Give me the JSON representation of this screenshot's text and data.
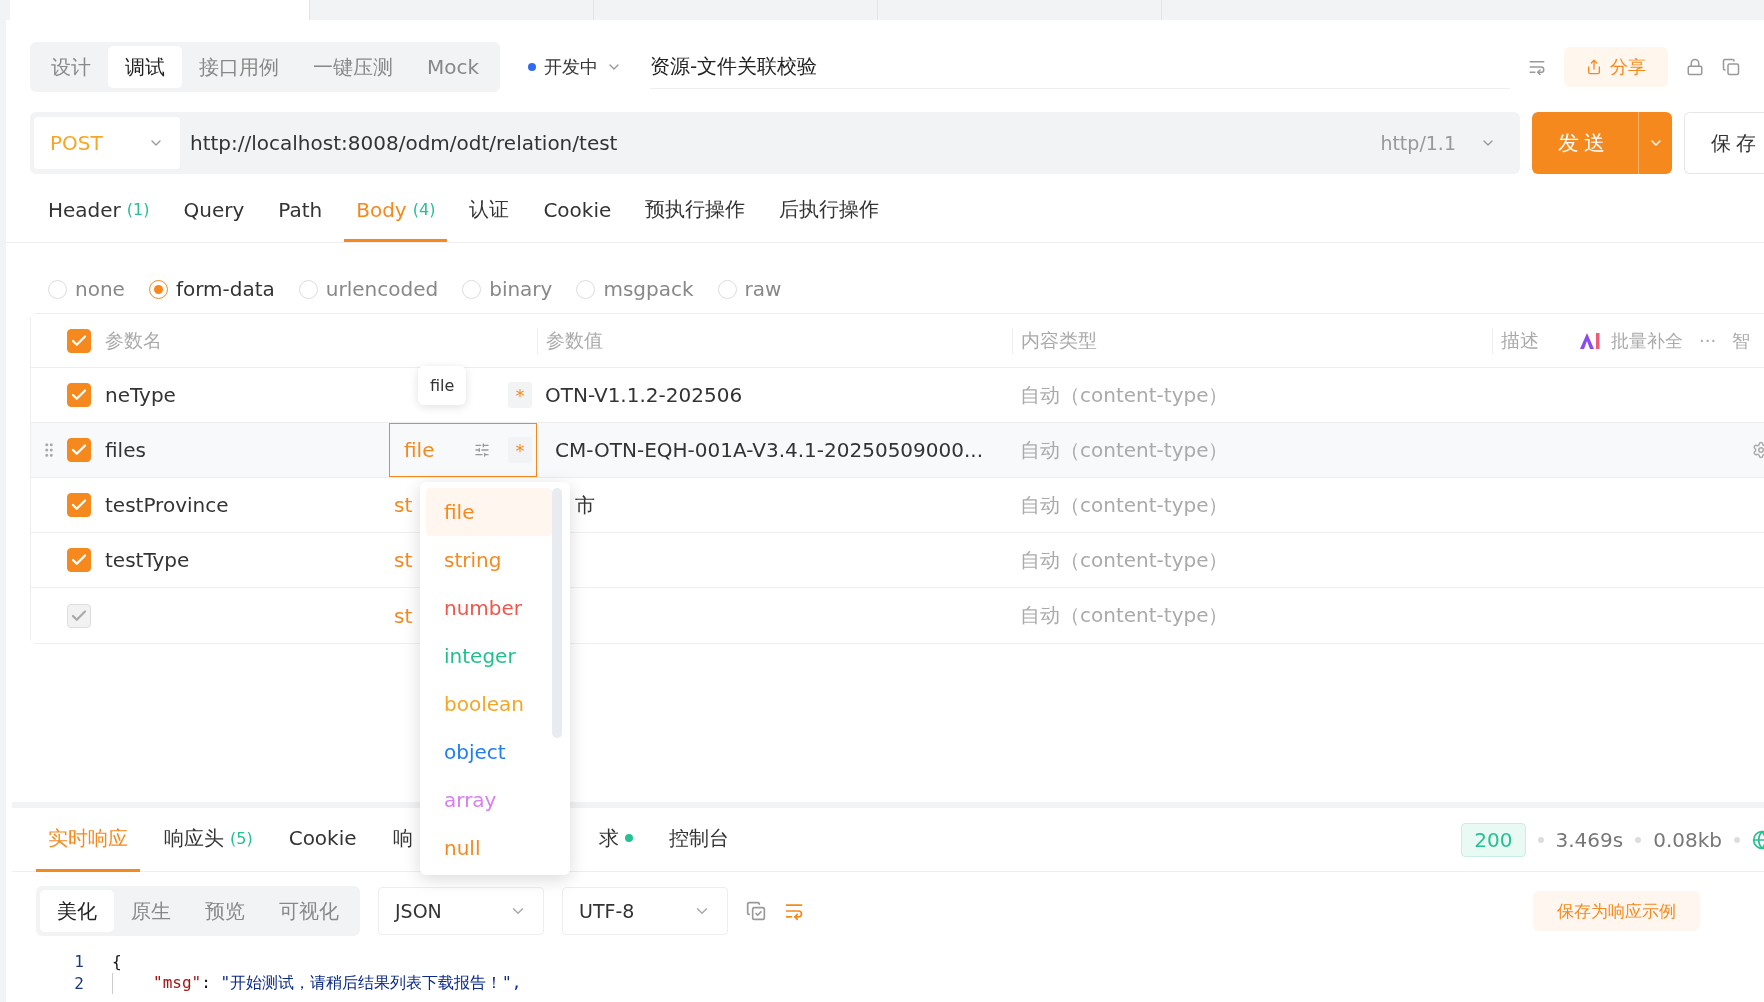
{
  "browser_tabs": [
    {
      "selected": true
    },
    {
      "selected": false
    },
    {
      "selected": false
    },
    {
      "selected": false
    }
  ],
  "mode_tabs": [
    {
      "label": "设计",
      "selected": false
    },
    {
      "label": "调试",
      "selected": true
    },
    {
      "label": "接口用例",
      "selected": false
    },
    {
      "label": "一键压测",
      "selected": false
    },
    {
      "label": "Mock",
      "selected": false
    }
  ],
  "status": {
    "label": "开发中",
    "color": "#2f6bf0"
  },
  "api_name": "资源-文件关联校验",
  "share": "分享",
  "request": {
    "method": "POST",
    "url": "http://localhost:8008/odm/odt/relation/test",
    "protocol": "http/1.1",
    "send": "发送",
    "save": "保存"
  },
  "request_tabs": [
    {
      "label": "Header",
      "count": "(1)",
      "selected": false
    },
    {
      "label": "Query",
      "selected": false
    },
    {
      "label": "Path",
      "selected": false
    },
    {
      "label": "Body",
      "count": "(4)",
      "selected": true
    },
    {
      "label": "认证",
      "selected": false
    },
    {
      "label": "Cookie",
      "selected": false
    },
    {
      "label": "预执行操作",
      "selected": false
    },
    {
      "label": "后执行操作",
      "selected": false
    }
  ],
  "body_types": [
    {
      "label": "none",
      "selected": false
    },
    {
      "label": "form-data",
      "selected": true
    },
    {
      "label": "urlencoded",
      "selected": false
    },
    {
      "label": "binary",
      "selected": false
    },
    {
      "label": "msgpack",
      "selected": false
    },
    {
      "label": "raw",
      "selected": false
    }
  ],
  "table": {
    "header_checked": true,
    "columns": [
      "参数名",
      "参数值",
      "内容类型",
      "描述"
    ],
    "batch": "批量补全",
    "more": "···",
    "smart": "智",
    "rows": [
      {
        "checked": true,
        "kind": "param",
        "name": "neType",
        "required": "*",
        "value": "OTN-V1.1.2-202506",
        "content_type": "自动（content-type）"
      },
      {
        "checked": true,
        "kind": "editing",
        "name": "files",
        "type": "file",
        "required": "*",
        "value": "CM-OTN-EQH-001A-V3.4.1-20250509000...",
        "content_type": "自动（content-type）"
      },
      {
        "checked": true,
        "kind": "covered",
        "name": "testProvince",
        "type": "st",
        "value": "市",
        "content_type": "自动（content-type）"
      },
      {
        "checked": true,
        "kind": "covered",
        "name": "testType",
        "type": "st",
        "content_type": "自动（content-type）"
      },
      {
        "checked": true,
        "disabled": true,
        "kind": "covered",
        "type": "st",
        "content_type": "自动（content-type）"
      }
    ]
  },
  "tooltip": "file",
  "type_menu": [
    {
      "label": "file",
      "color": "#f5891e",
      "selected": true
    },
    {
      "label": "string",
      "color": "#f5891e",
      "selected": false
    },
    {
      "label": "number",
      "color": "#f0564a",
      "selected": false
    },
    {
      "label": "integer",
      "color": "#1fc08e",
      "selected": false
    },
    {
      "label": "boolean",
      "color": "#f5a623",
      "selected": false
    },
    {
      "label": "object",
      "color": "#1f7ef0",
      "selected": false
    },
    {
      "label": "array",
      "color": "#d77ef0",
      "selected": false
    },
    {
      "label": "null",
      "color": "#f5891e",
      "selected": false
    }
  ],
  "response_tabs": [
    {
      "label": "实时响应",
      "selected": true
    },
    {
      "label": "响应头",
      "count": "(5)",
      "selected": false
    },
    {
      "label": "Cookie",
      "selected": false
    },
    {
      "label": "响",
      "selected": false
    },
    {
      "label": "求",
      "dot": true,
      "selected": false
    },
    {
      "label": "控制台",
      "selected": false
    }
  ],
  "response_meta": {
    "status": "200",
    "time": "3.469s",
    "size": "0.08kb"
  },
  "view_modes": [
    {
      "label": "美化",
      "selected": true
    },
    {
      "label": "原生",
      "selected": false
    },
    {
      "label": "预览",
      "selected": false
    },
    {
      "label": "可视化",
      "selected": false
    }
  ],
  "format": "JSON",
  "encoding": "UTF-8",
  "save_example": "保存为响应示例",
  "code": [
    {
      "num": "1",
      "text": "{"
    },
    {
      "num": "2",
      "key": "\"msg\"",
      "sep": ": ",
      "value": "\"开始测试，请稍后结果列表下载报告！\","
    }
  ]
}
